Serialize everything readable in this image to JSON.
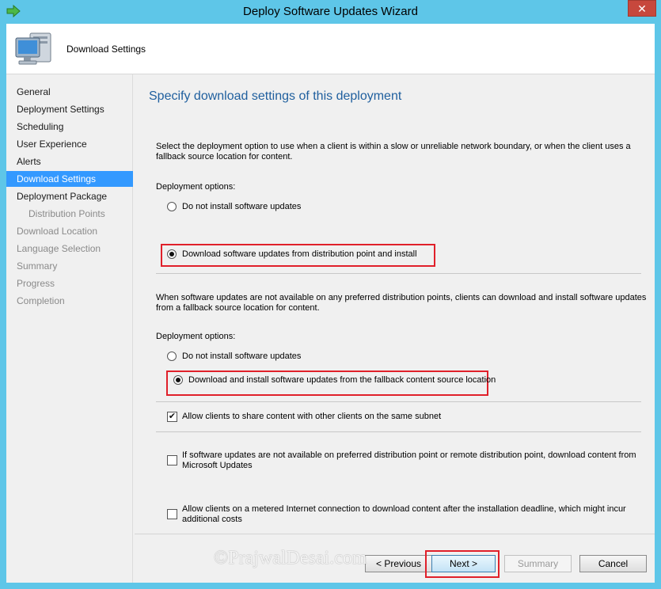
{
  "window": {
    "title": "Deploy Software Updates Wizard",
    "close_glyph": "✕",
    "accent_color": "#5ec6e8"
  },
  "header": {
    "title": "Download Settings",
    "icon": "computer-icon"
  },
  "nav": {
    "items": [
      {
        "label": "General",
        "state": "normal"
      },
      {
        "label": "Deployment Settings",
        "state": "normal"
      },
      {
        "label": "Scheduling",
        "state": "normal"
      },
      {
        "label": "User Experience",
        "state": "normal"
      },
      {
        "label": "Alerts",
        "state": "normal"
      },
      {
        "label": "Download Settings",
        "state": "active"
      },
      {
        "label": "Deployment Package",
        "state": "normal"
      },
      {
        "label": "Distribution Points",
        "state": "disabled"
      },
      {
        "label": "Download Location",
        "state": "disabled"
      },
      {
        "label": "Language Selection",
        "state": "disabled"
      },
      {
        "label": "Summary",
        "state": "disabled"
      },
      {
        "label": "Progress",
        "state": "disabled"
      },
      {
        "label": "Completion",
        "state": "disabled"
      }
    ]
  },
  "main": {
    "heading": "Specify download settings of this deployment",
    "section1": {
      "description_line1": "Select the deployment option to use when a client is within a slow or unreliable network boundary, or when the client uses a",
      "description_line2": "fallback source location for content.",
      "options_label": "Deployment options:",
      "option_no_install": "Do not install software updates",
      "option_download": "Download software updates from distribution point and install",
      "selected": "option_download"
    },
    "section2": {
      "description_line1": "When software updates are not available on any preferred distribution points, clients can download and install software updates",
      "description_line2": "from a fallback source location for content.",
      "options_label": "Deployment options:",
      "option_no_install": "Do not install software updates",
      "option_fallback": "Download and install software updates from the fallback content source location",
      "selected": "option_fallback"
    },
    "share_subnet": {
      "label": "Allow clients to share content with other clients on the same subnet",
      "checked": true
    },
    "microsoft_updates": {
      "label_line1": "If software updates are not available on preferred distribution point or remote distribution point, download content from",
      "label_line2": "Microsoft Updates",
      "checked": false
    },
    "metered": {
      "label_line1": "Allow clients on a metered Internet connection to download content after the installation deadline, which might incur",
      "label_line2": "additional costs",
      "checked": false
    }
  },
  "footer": {
    "previous": "< Previous",
    "next": "Next >",
    "summary": "Summary",
    "cancel": "Cancel"
  },
  "watermark": "©PrajwalDesai.com"
}
